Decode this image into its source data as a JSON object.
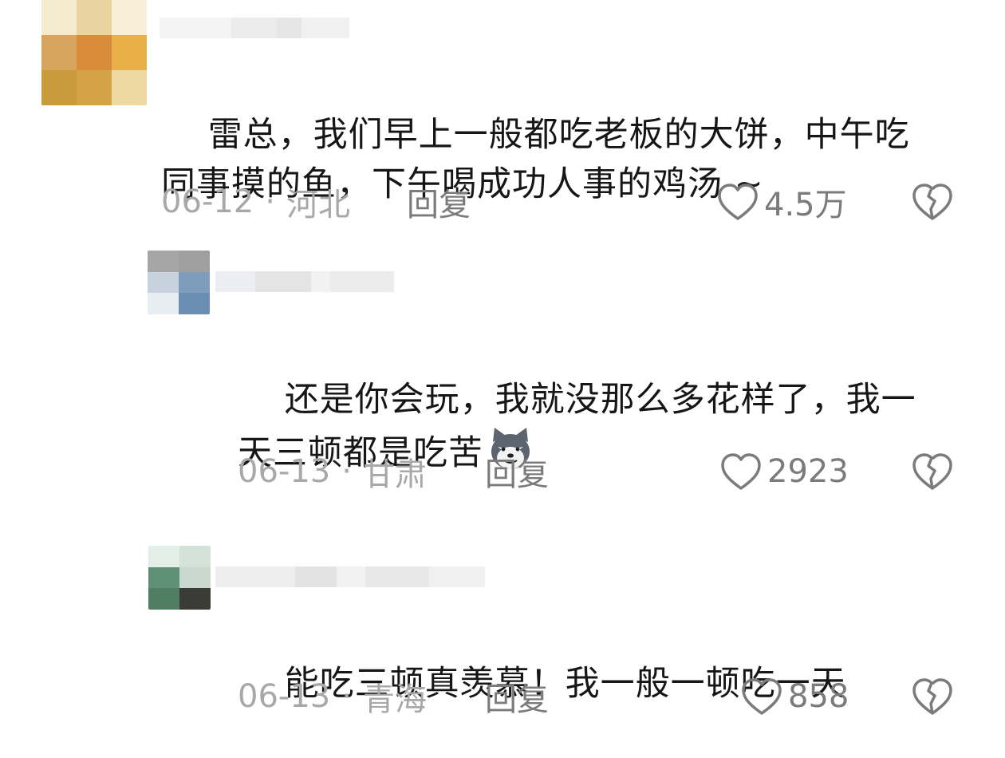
{
  "comments": [
    {
      "content_lines": [
        "雷总，我们早上一般都吃老板的大饼，中午吃",
        "同事摸的鱼，下午喝成功人事的鸡汤 ~"
      ],
      "date": "06-12",
      "location": "河北",
      "reply_label": "回复",
      "likes": "4.5万",
      "avatar_colors": [
        "#e9d4a0",
        "#d6b66a",
        "#f0d89a",
        "#cfa04a",
        "#d9902f",
        "#e6b04c",
        "#d7c07b",
        "#c9952c",
        "#ecc376"
      ]
    },
    {
      "content_lines": [
        "还是你会玩，我就没那么多花样了，我一",
        "天三顿都是吃苦"
      ],
      "emoji": "husky-grin-icon",
      "date": "06-13",
      "location": "甘肃",
      "reply_label": "回复",
      "likes": "2923",
      "avatar_colors": [
        "#9a9a9a",
        "#c9cbcf",
        "#8aa3bd",
        "#6f8fb3",
        "#b8c7d9",
        "#5b83b0"
      ]
    },
    {
      "content_lines": [
        "能吃三顿真羡慕！我一般一顿吃一天"
      ],
      "date": "06-13",
      "location": "青海",
      "reply_label": "回复",
      "likes": "858",
      "avatar_colors": [
        "#cfe2d6",
        "#6e9a82",
        "#dfe9e3",
        "#4d7a5f",
        "#3a3a36",
        "#8db29e"
      ]
    }
  ],
  "separator": "·",
  "colors": {
    "text": "#161616",
    "meta": "#a8a8a8",
    "action": "#7b7b7b",
    "icon": "#7b7b7b"
  }
}
